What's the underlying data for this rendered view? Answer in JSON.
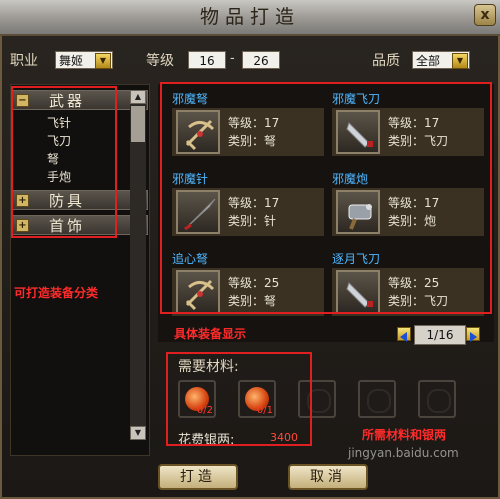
{
  "window": {
    "title": "物品打造",
    "close_label": "x"
  },
  "filters": {
    "job_label": "职业",
    "job_value": "舞姬",
    "level_label": "等级",
    "level_min": "16",
    "level_sep": "-",
    "level_max": "26",
    "quality_label": "品质",
    "quality_value": "全部"
  },
  "categories": [
    {
      "label": "武器",
      "expanded": true,
      "items": [
        "飞针",
        "飞刀",
        "弩",
        "手炮"
      ]
    },
    {
      "label": "防具",
      "expanded": false
    },
    {
      "label": "首饰",
      "expanded": false
    }
  ],
  "equipment": [
    {
      "name": "邪魔弩",
      "level": "等级：17",
      "type": "类别：弩",
      "icon": "crossbow-icon"
    },
    {
      "name": "邪魔飞刀",
      "level": "等级：17",
      "type": "类别：飞刀",
      "icon": "flying-knife-icon"
    },
    {
      "name": "邪魔针",
      "level": "等级：17",
      "type": "类别：针",
      "icon": "needle-icon"
    },
    {
      "name": "邪魔炮",
      "level": "等级：17",
      "type": "类别：炮",
      "icon": "hand-cannon-icon"
    },
    {
      "name": "追心弩",
      "level": "等级：25",
      "type": "类别：弩",
      "icon": "crossbow-icon"
    },
    {
      "name": "逐月飞刀",
      "level": "等级：25",
      "type": "类别：飞刀",
      "icon": "flying-knife-icon"
    }
  ],
  "pager": {
    "text": "1/16"
  },
  "materials": {
    "label": "需要材料:",
    "slots": [
      {
        "count": "0/2",
        "icon": "material-orb-icon"
      },
      {
        "count": "0/1",
        "icon": "material-orb-icon"
      },
      {
        "count": ""
      },
      {
        "count": ""
      },
      {
        "count": ""
      }
    ],
    "cost_label": "花费银两:",
    "cost_value": "3400"
  },
  "buttons": {
    "craft": "打造",
    "cancel": "取消"
  },
  "annotations": {
    "left": "可打造装备分类",
    "grid": "具体装备显示",
    "materials": "所需材料和银两"
  },
  "watermark": "jingyan.baidu.com"
}
